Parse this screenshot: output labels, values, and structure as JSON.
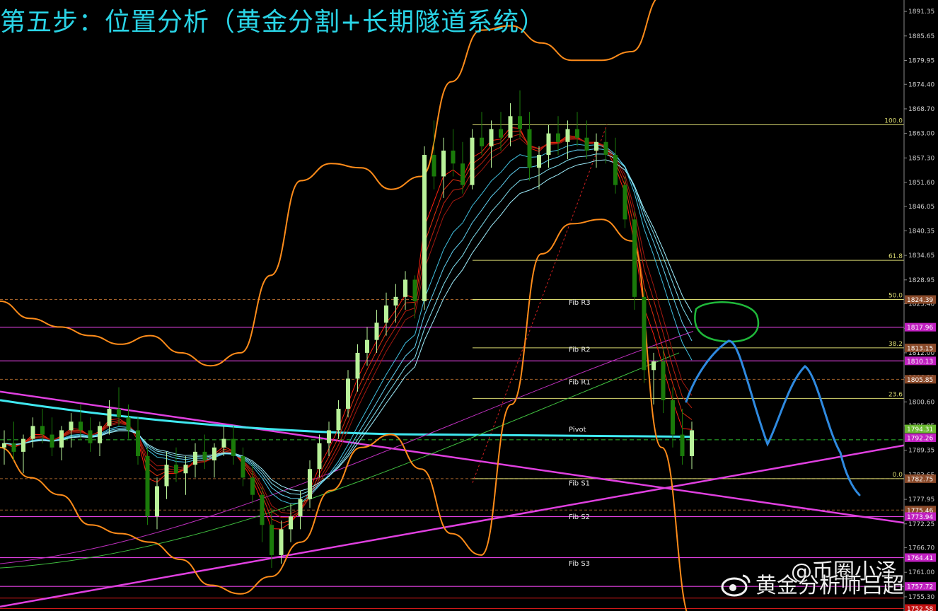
{
  "title": "第五步：位置分析（黄金分割+长期隧道系统）",
  "watermark": {
    "line1": "@币圈小泽",
    "line2": "黄金分析师吕超",
    "logo": "weibo-logo"
  },
  "colors": {
    "background": "#000000",
    "title": "#2ad4e6",
    "candle_up": "#b9f29a",
    "candle_down": "#1a7a0a",
    "bollinger": "#ff8c1a",
    "trendline": "#e040e0",
    "fib_line": "#d8d870",
    "pivot_line": "#c040c0",
    "hand_drawn": "#2f8ae0",
    "circle": "#1fb83a",
    "axis_text": "#d0d0d0"
  },
  "chart_data": {
    "type": "candlestick",
    "instrument": "Gold",
    "ylim": [
      1752,
      1894
    ],
    "y_ticks": [
      "1891.35",
      "1885.65",
      "1879.95",
      "1874.40",
      "1868.70",
      "1863.00",
      "1857.30",
      "1851.60",
      "1846.05",
      "1840.35",
      "1834.65",
      "1828.95",
      "1823.40",
      "1817.70",
      "1812.00",
      "1806.30",
      "1800.60",
      "1795.05",
      "1789.35",
      "1783.65",
      "1777.95",
      "1772.25",
      "1766.70",
      "1761.00",
      "1755.30"
    ],
    "price_labels": [
      {
        "text": "1824.39",
        "value": 1824.39,
        "color": "#8a4a2a"
      },
      {
        "text": "1817.96",
        "value": 1817.96,
        "color": "#c020c0"
      },
      {
        "text": "1813.15",
        "value": 1813.15,
        "color": "#8a4a2a"
      },
      {
        "text": "1810.13",
        "value": 1810.13,
        "color": "#c020c0"
      },
      {
        "text": "1805.85",
        "value": 1805.85,
        "color": "#8a4a2a"
      },
      {
        "text": "1794.31",
        "value": 1794.31,
        "color": "#6ab830"
      },
      {
        "text": "1792.26",
        "value": 1792.26,
        "color": "#c020c0"
      },
      {
        "text": "1782.75",
        "value": 1782.75,
        "color": "#8a4a2a"
      },
      {
        "text": "1775.46",
        "value": 1775.46,
        "color": "#8a4a2a"
      },
      {
        "text": "1773.94",
        "value": 1773.94,
        "color": "#c020c0"
      },
      {
        "text": "1764.41",
        "value": 1764.41,
        "color": "#c020c0"
      },
      {
        "text": "1757.72",
        "value": 1757.72,
        "color": "#c020c0"
      },
      {
        "text": "1752.58",
        "value": 1752.58,
        "color": "#c01010"
      }
    ],
    "fib_levels": [
      {
        "label": "100.0",
        "value": 1865.0
      },
      {
        "label": "61.8",
        "value": 1833.5
      },
      {
        "label": "50.0",
        "value": 1824.39
      },
      {
        "label": "38.2",
        "value": 1813.15
      },
      {
        "label": "23.6",
        "value": 1801.4
      },
      {
        "label": "0.0",
        "value": 1782.75
      }
    ],
    "pivot_levels": [
      {
        "label": "Fib R3",
        "value": 1823.8
      },
      {
        "label": "Fib R2",
        "value": 1812.9
      },
      {
        "label": "Fib R1",
        "value": 1805.3
      },
      {
        "label": "Pivot",
        "value": 1794.3
      },
      {
        "label": "Fib S1",
        "value": 1781.8
      },
      {
        "label": "Fib S2",
        "value": 1774.0
      },
      {
        "label": "Fib S3",
        "value": 1763.2
      }
    ],
    "magenta_levels": [
      1817.96,
      1810.13,
      1773.94,
      1764.41,
      1757.72
    ],
    "red_levels": [
      1752.58,
      1755.0
    ],
    "close_line": 1791.8,
    "candles": [
      [
        1790,
        1794,
        1786,
        1791
      ],
      [
        1791,
        1796,
        1787,
        1789
      ],
      [
        1789,
        1793,
        1784,
        1792
      ],
      [
        1792,
        1797,
        1790,
        1795
      ],
      [
        1795,
        1799,
        1791,
        1793
      ],
      [
        1793,
        1797,
        1788,
        1790
      ],
      [
        1790,
        1795,
        1787,
        1794
      ],
      [
        1794,
        1798,
        1790,
        1796
      ],
      [
        1796,
        1800,
        1792,
        1794
      ],
      [
        1794,
        1797,
        1789,
        1791
      ],
      [
        1791,
        1796,
        1788,
        1795
      ],
      [
        1795,
        1801,
        1793,
        1799
      ],
      [
        1799,
        1804,
        1795,
        1797
      ],
      [
        1797,
        1800,
        1792,
        1794
      ],
      [
        1794,
        1797,
        1786,
        1788
      ],
      [
        1788,
        1790,
        1772,
        1774
      ],
      [
        1774,
        1783,
        1771,
        1781
      ],
      [
        1781,
        1789,
        1778,
        1786
      ],
      [
        1786,
        1790,
        1782,
        1784
      ],
      [
        1784,
        1788,
        1779,
        1786
      ],
      [
        1786,
        1791,
        1783,
        1789
      ],
      [
        1789,
        1793,
        1785,
        1787
      ],
      [
        1787,
        1791,
        1783,
        1790
      ],
      [
        1790,
        1795,
        1788,
        1792
      ],
      [
        1792,
        1795,
        1786,
        1788
      ],
      [
        1788,
        1790,
        1781,
        1783
      ],
      [
        1783,
        1786,
        1777,
        1779
      ],
      [
        1779,
        1781,
        1768,
        1772
      ],
      [
        1772,
        1776,
        1762,
        1765
      ],
      [
        1765,
        1773,
        1763,
        1771
      ],
      [
        1771,
        1777,
        1768,
        1774
      ],
      [
        1774,
        1780,
        1771,
        1778
      ],
      [
        1778,
        1787,
        1776,
        1785
      ],
      [
        1785,
        1793,
        1783,
        1791
      ],
      [
        1791,
        1796,
        1788,
        1794
      ],
      [
        1794,
        1801,
        1792,
        1799
      ],
      [
        1799,
        1808,
        1797,
        1806
      ],
      [
        1806,
        1814,
        1803,
        1812
      ],
      [
        1812,
        1818,
        1809,
        1815
      ],
      [
        1815,
        1822,
        1812,
        1819
      ],
      [
        1819,
        1826,
        1816,
        1823
      ],
      [
        1823,
        1828,
        1819,
        1825
      ],
      [
        1825,
        1831,
        1822,
        1829
      ],
      [
        1829,
        1830,
        1820,
        1824
      ],
      [
        1824,
        1860,
        1822,
        1858
      ],
      [
        1858,
        1866,
        1850,
        1853
      ],
      [
        1853,
        1862,
        1848,
        1859
      ],
      [
        1859,
        1864,
        1853,
        1856
      ],
      [
        1856,
        1861,
        1849,
        1851
      ],
      [
        1851,
        1864,
        1850,
        1862
      ],
      [
        1862,
        1868,
        1858,
        1860
      ],
      [
        1860,
        1866,
        1855,
        1864
      ],
      [
        1864,
        1868,
        1859,
        1862
      ],
      [
        1862,
        1870,
        1860,
        1867
      ],
      [
        1867,
        1873,
        1862,
        1864
      ],
      [
        1864,
        1868,
        1852,
        1855
      ],
      [
        1855,
        1860,
        1850,
        1858
      ],
      [
        1858,
        1865,
        1855,
        1863
      ],
      [
        1863,
        1867,
        1858,
        1861
      ],
      [
        1861,
        1866,
        1857,
        1864
      ],
      [
        1864,
        1868,
        1860,
        1862
      ],
      [
        1862,
        1866,
        1857,
        1859
      ],
      [
        1859,
        1863,
        1855,
        1861
      ],
      [
        1861,
        1864,
        1856,
        1858
      ],
      [
        1858,
        1862,
        1849,
        1851
      ],
      [
        1851,
        1853,
        1841,
        1843
      ],
      [
        1843,
        1845,
        1822,
        1825
      ],
      [
        1825,
        1827,
        1805,
        1808
      ],
      [
        1808,
        1812,
        1800,
        1810
      ],
      [
        1810,
        1813,
        1798,
        1801
      ],
      [
        1801,
        1804,
        1790,
        1793
      ],
      [
        1793,
        1799,
        1786,
        1788
      ],
      [
        1788,
        1796,
        1785,
        1794
      ]
    ],
    "bollinger_upper": [
      1824,
      1820,
      1818,
      1816,
      1814,
      1816,
      1812,
      1809,
      1812,
      1830,
      1852,
      1856,
      1855,
      1850,
      1853,
      1875,
      1887,
      1888,
      1884,
      1880,
      1880,
      1882,
      1895,
      1900
    ],
    "bollinger_lower": [
      1790,
      1783,
      1779,
      1772,
      1770,
      1768,
      1764,
      1758,
      1756,
      1760,
      1768,
      1780,
      1790,
      1793,
      1785,
      1770,
      1765,
      1800,
      1835,
      1842,
      1843,
      1838,
      1790,
      1750
    ],
    "annotations": {
      "green_circle": "target resistance zone near 1813",
      "blue_path": "projected rebound then decline"
    }
  }
}
